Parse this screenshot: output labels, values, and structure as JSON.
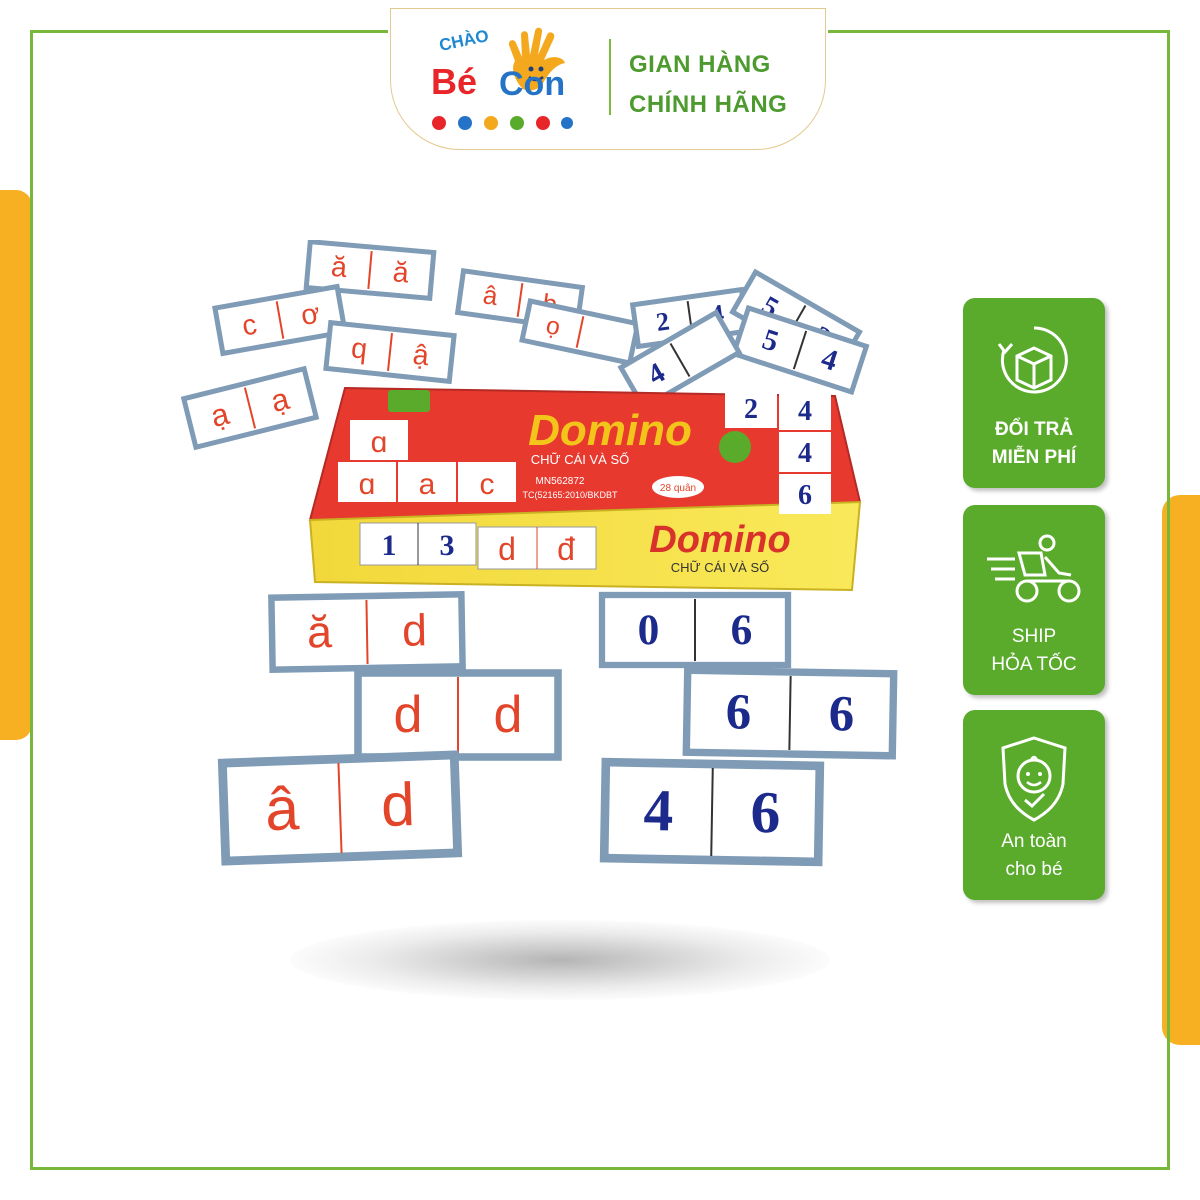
{
  "header": {
    "logo_top": "CHÀO",
    "logo_be": "Bé",
    "logo_con": "Con",
    "line1": "GIAN HÀNG",
    "line2": "CHÍNH HÃNG"
  },
  "badges": [
    {
      "icon": "box-return-icon",
      "line1": "ĐỔI TRẢ",
      "line2": "MIỄN PHÍ"
    },
    {
      "icon": "delivery-scooter-icon",
      "line1": "SHIP",
      "line2": "HỎA TỐC"
    },
    {
      "icon": "baby-shield-icon",
      "line1": "An toàn",
      "line2": "cho bé"
    }
  ],
  "product": {
    "box_title": "Domino",
    "box_subtitle": "CHỮ CÁI VÀ SỐ",
    "box_code": "MN562872",
    "box_meta": "TC(52165:2010/BKDBT",
    "box_count": "28 quân",
    "box_front_tiles": [
      "1",
      "3",
      "d",
      "đ"
    ],
    "box_top_letters": [
      "ɑ",
      "ɑ",
      "a",
      "c"
    ],
    "box_top_numbers": [
      "2",
      "4",
      "4",
      "6"
    ],
    "front_tiles": [
      {
        "left": "ă",
        "right": "d",
        "kind": "letter"
      },
      {
        "left": "d",
        "right": "d",
        "kind": "letter"
      },
      {
        "left": "â",
        "right": "d",
        "kind": "letter"
      },
      {
        "left": "0",
        "right": "6",
        "kind": "number"
      },
      {
        "left": "6",
        "right": "6",
        "kind": "number"
      },
      {
        "left": "4",
        "right": "6",
        "kind": "number"
      }
    ],
    "back_tiles": [
      "ă",
      "ă",
      "c",
      "ơ",
      "â",
      "b",
      "q",
      "ậ",
      "ạ",
      "ạ",
      "ọ",
      "2",
      "4",
      "5",
      "3",
      "5",
      "4",
      "4"
    ]
  },
  "colors": {
    "brand_green": "#5aab2c",
    "accent_yellow": "#f7b021",
    "letter_red": "#e2452a",
    "number_blue": "#1c2a8c",
    "tile_frame": "#7f9bb5"
  }
}
